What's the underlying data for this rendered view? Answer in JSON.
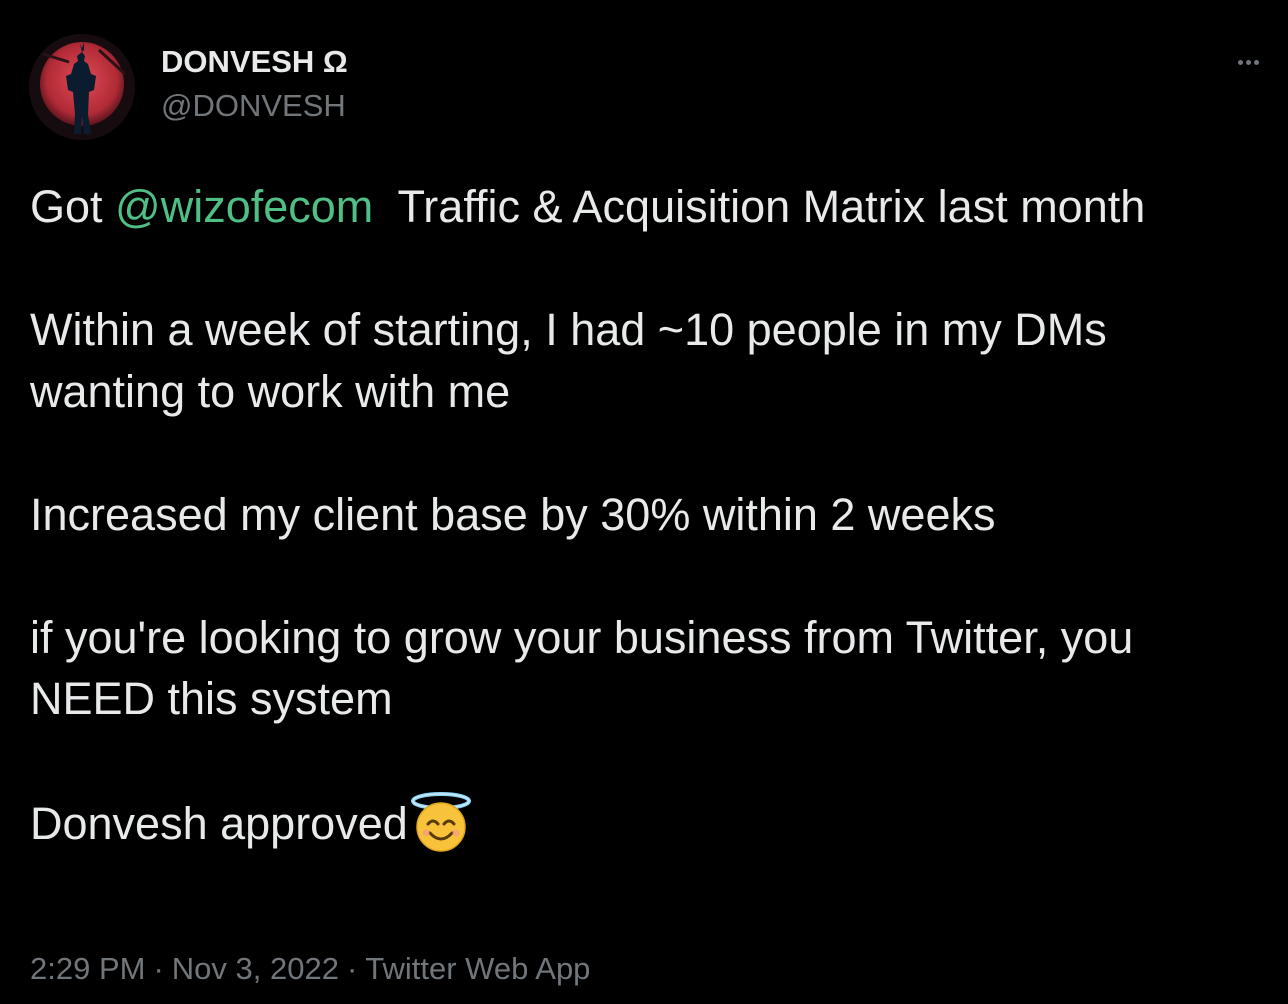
{
  "author": {
    "display_name": "DONVESH Ω",
    "handle": "@DONVESH"
  },
  "tweet": {
    "line1_prefix": "Got ",
    "mention": "@wizofecom",
    "line1_suffix": "  Traffic & Acquisition Matrix last month",
    "para2": "Within a week of starting, I had ~10 people in my DMs wanting to work with me",
    "para3": "Increased my client base by 30% within 2 weeks",
    "para4": "if you're looking to grow your business from Twitter, you NEED this system",
    "para5": "Donvesh approved",
    "emoji": "smiling-face-with-halo"
  },
  "meta": {
    "time": "2:29 PM",
    "separator": "·",
    "date": "Nov 3, 2022",
    "source": "Twitter Web App"
  },
  "colors": {
    "background": "#000000",
    "text": "#e7e9ea",
    "secondary": "#71767b",
    "mention": "#4fbf86"
  }
}
